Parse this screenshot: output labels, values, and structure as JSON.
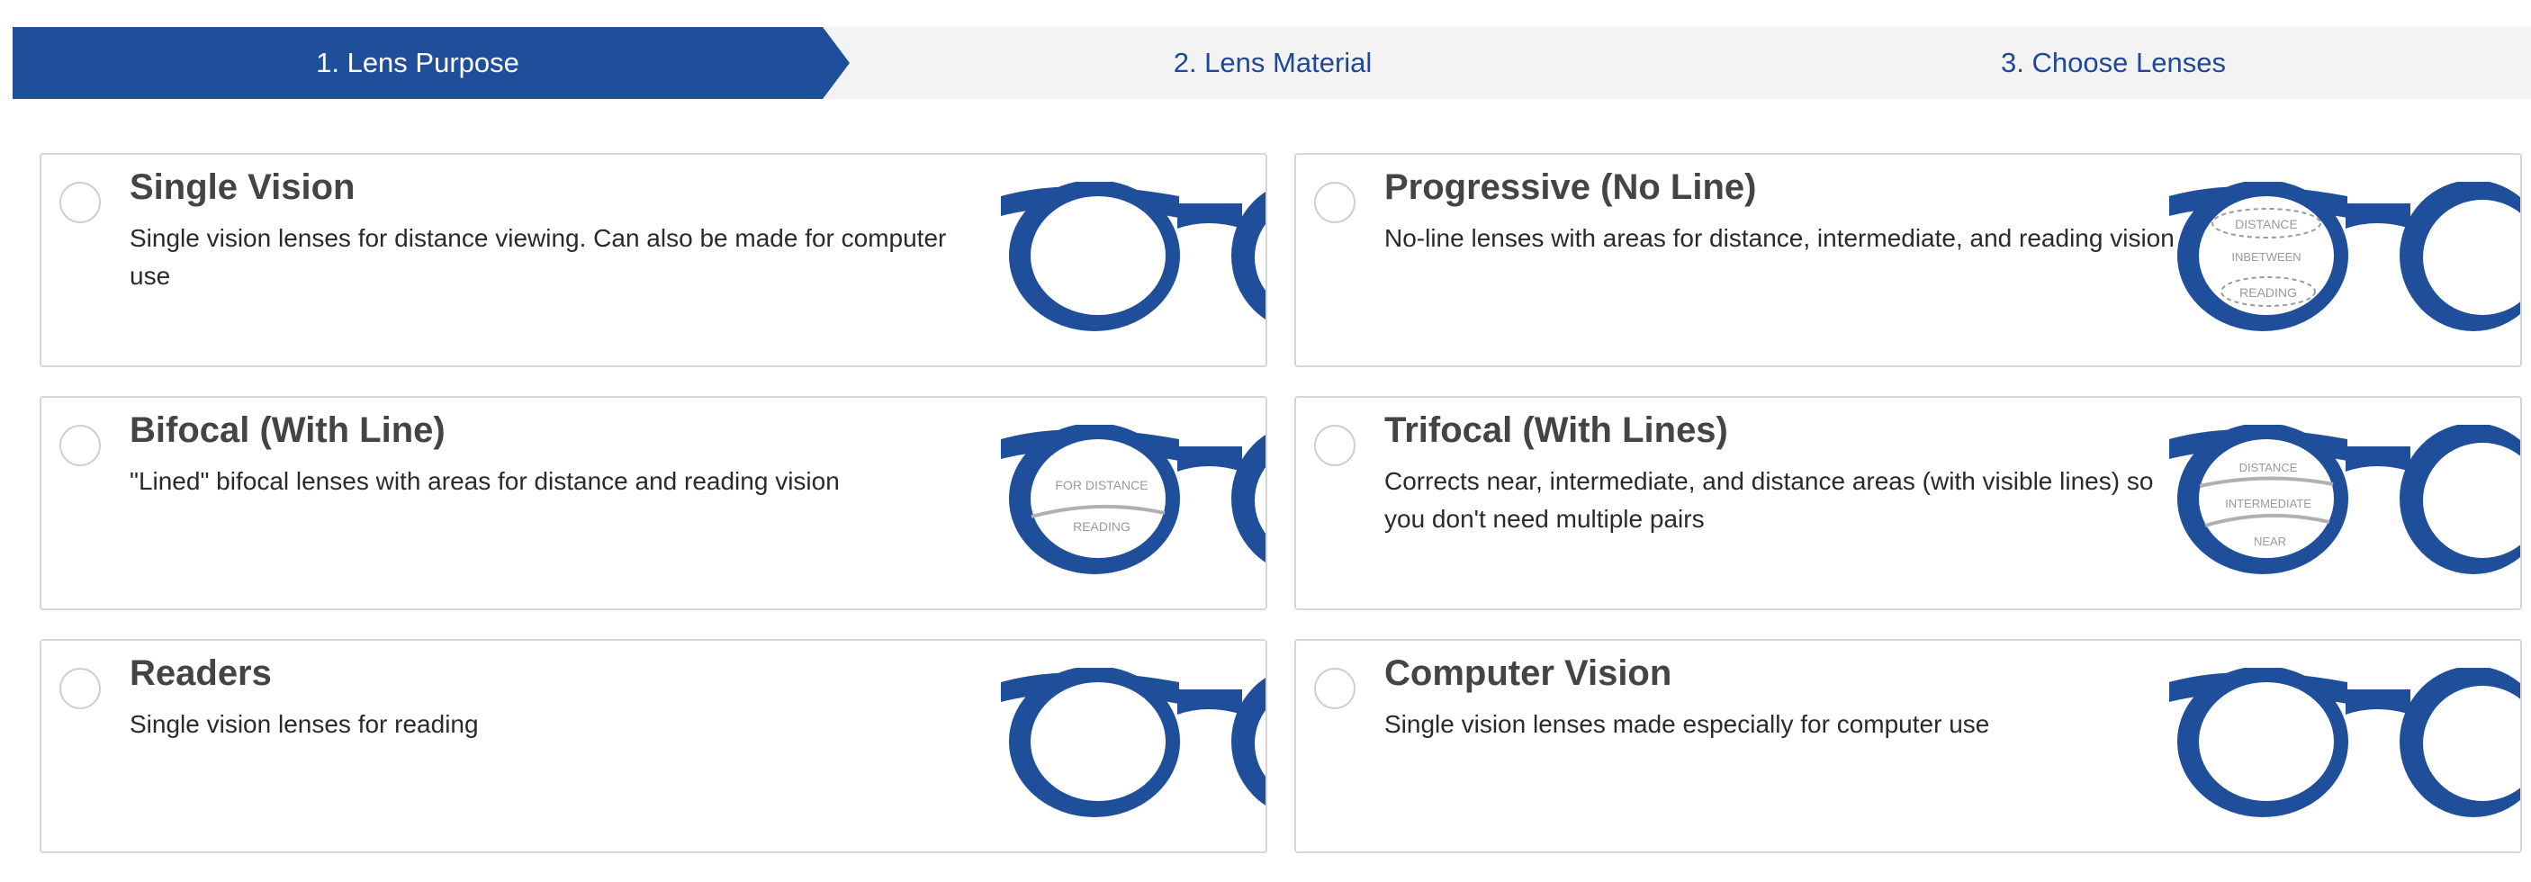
{
  "stepper": {
    "steps": [
      {
        "label": "1. Lens Purpose",
        "active": true
      },
      {
        "label": "2. Lens Material",
        "active": false
      },
      {
        "label": "3. Choose Lenses",
        "active": false
      }
    ]
  },
  "colors": {
    "brand_blue": "#1f4f9b",
    "step_text_blue": "#21479a",
    "lens_label_grey": "#9a9a9a"
  },
  "options": [
    {
      "title": "Single Vision",
      "description": "Single vision lenses for distance viewing. Can also be made for computer use",
      "icon": "single-vision-glasses-icon",
      "lens_labels": []
    },
    {
      "title": "Progressive (No Line)",
      "description": "No-line lenses with areas for distance, intermediate, and reading vision",
      "icon": "progressive-glasses-icon",
      "lens_labels": [
        "DISTANCE",
        "INBETWEEN",
        "READING"
      ]
    },
    {
      "title": "Bifocal (With Line)",
      "description": "\"Lined\" bifocal lenses with areas for distance and reading vision",
      "icon": "bifocal-glasses-icon",
      "lens_labels": [
        "FOR DISTANCE",
        "READING"
      ]
    },
    {
      "title": "Trifocal (With Lines)",
      "description": "Corrects near, intermediate, and distance areas (with visible lines) so you don't need multiple pairs",
      "icon": "trifocal-glasses-icon",
      "lens_labels": [
        "DISTANCE",
        "INTERMEDIATE",
        "NEAR"
      ]
    },
    {
      "title": "Readers",
      "description": "Single vision lenses for reading",
      "icon": "readers-glasses-icon",
      "lens_labels": []
    },
    {
      "title": "Computer Vision",
      "description": "Single vision lenses made especially for computer use",
      "icon": "computer-vision-glasses-icon",
      "lens_labels": []
    }
  ]
}
